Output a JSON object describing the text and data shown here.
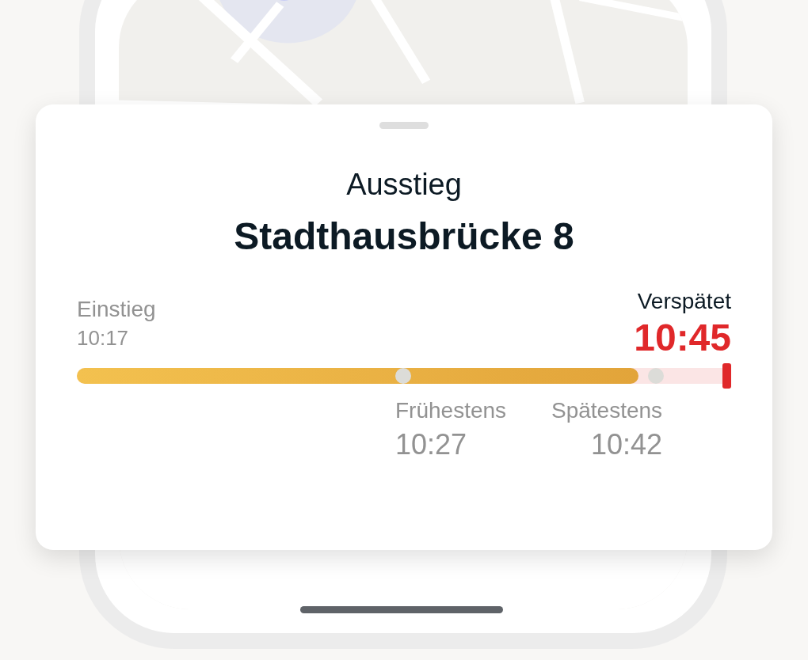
{
  "card": {
    "title": "Ausstieg",
    "stop": "Stadthausbrücke 8",
    "start": {
      "label": "Einstieg",
      "time": "10:17"
    },
    "status": {
      "label": "Verspätet",
      "time": "10:45",
      "delayed": true
    },
    "progress": {
      "level": 0.87
    },
    "markers": [
      {
        "label": "Frühestens",
        "time": "10:27"
      },
      {
        "label": "Spätestens",
        "time": "10:42"
      }
    ]
  }
}
